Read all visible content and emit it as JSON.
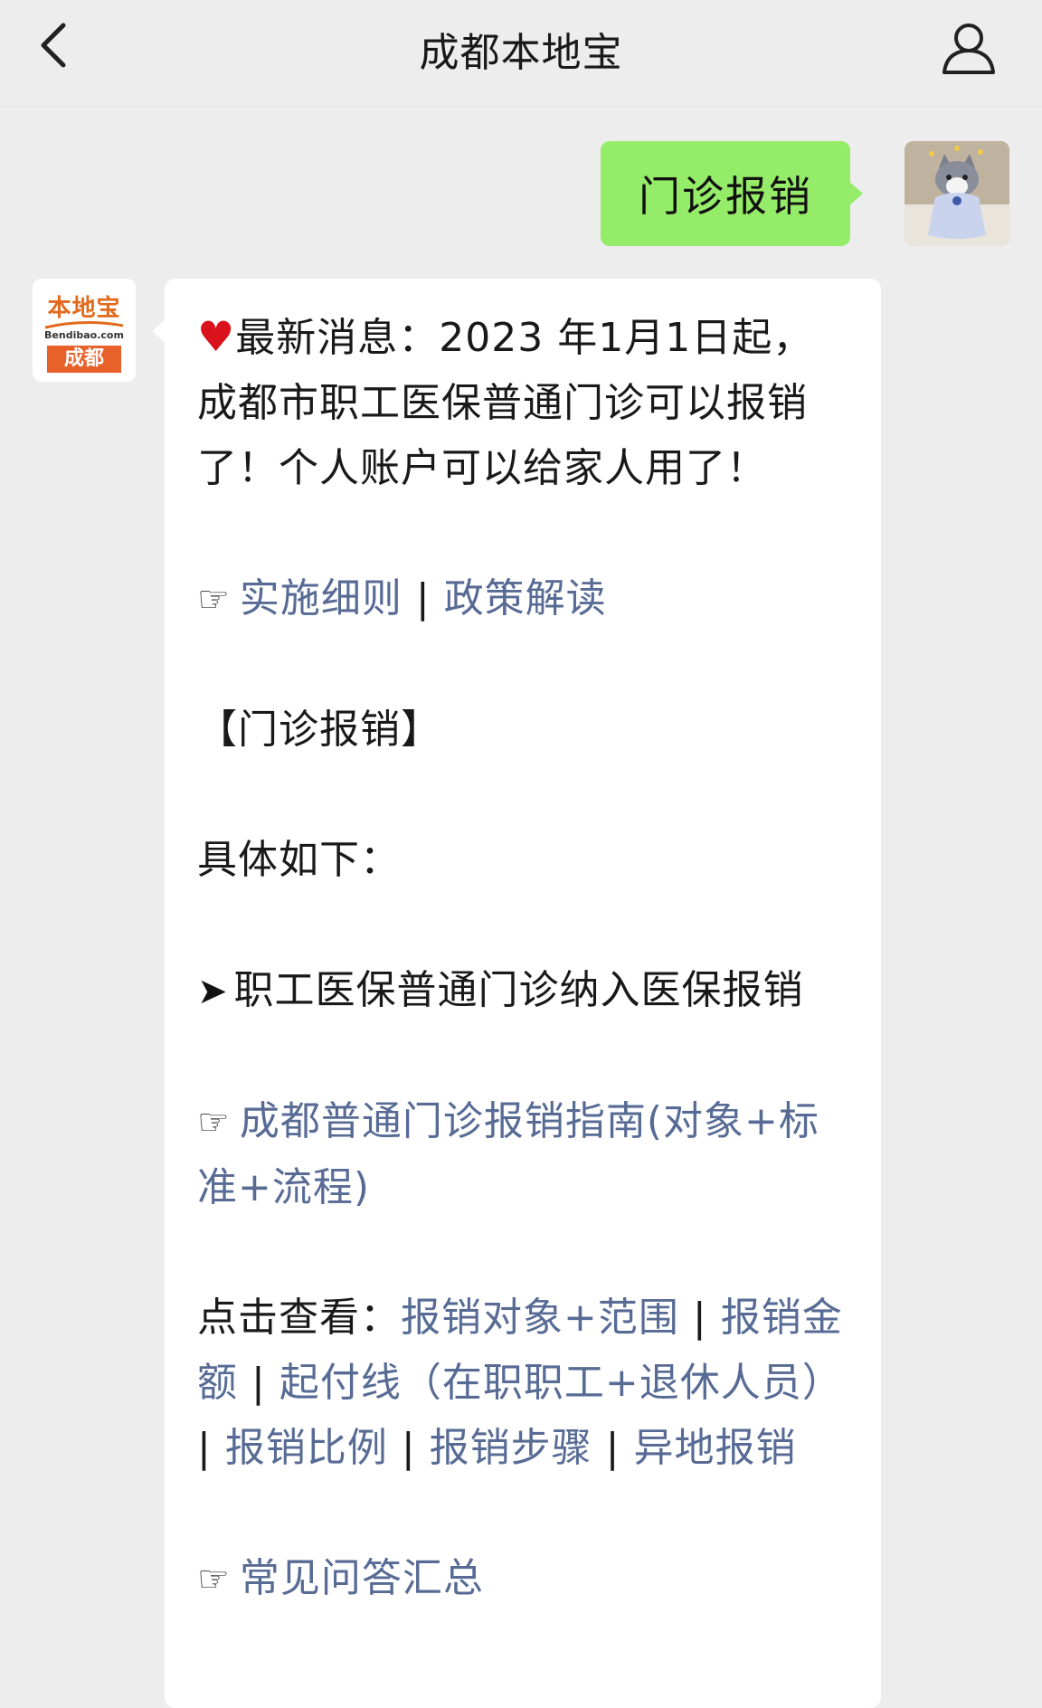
{
  "header": {
    "title": "成都本地宝"
  },
  "outgoing": {
    "text": "门诊报销"
  },
  "message": {
    "intro_icon": "♥",
    "intro_text": "最新消息：2023 年1月1日起，成都市职工医保普通门诊可以报销了！个人账户可以给家人用了！",
    "pointer_icon": "☞",
    "links_row1": [
      "实施细则",
      "政策解读"
    ],
    "separator": "|",
    "section_title": "【门诊报销】",
    "details_label": "具体如下：",
    "arrow_icon": "➤",
    "arrow_item": "职工医保普通门诊纳入医保报销",
    "guide_link": "成都普通门诊报销指南(对象+标准+流程)",
    "view_label": "点击查看：",
    "view_links": [
      "报销对象+范围",
      "报销金额",
      "起付线（在职职工+退休人员）",
      "报销比例",
      "报销步骤",
      "异地报销"
    ],
    "faq_link": "常见问答汇总"
  },
  "bot_avatar": {
    "logo_top": "本地宝",
    "logo_url": "Bendibao.com",
    "logo_city": "成都"
  },
  "icons": {
    "back": "chevron-left-icon",
    "profile": "person-icon"
  },
  "colors": {
    "page_bg": "#ededed",
    "outgoing_bubble": "#95ec69",
    "link": "#576b95",
    "heart": "#d9121c",
    "logo_orange": "#e8612a"
  }
}
